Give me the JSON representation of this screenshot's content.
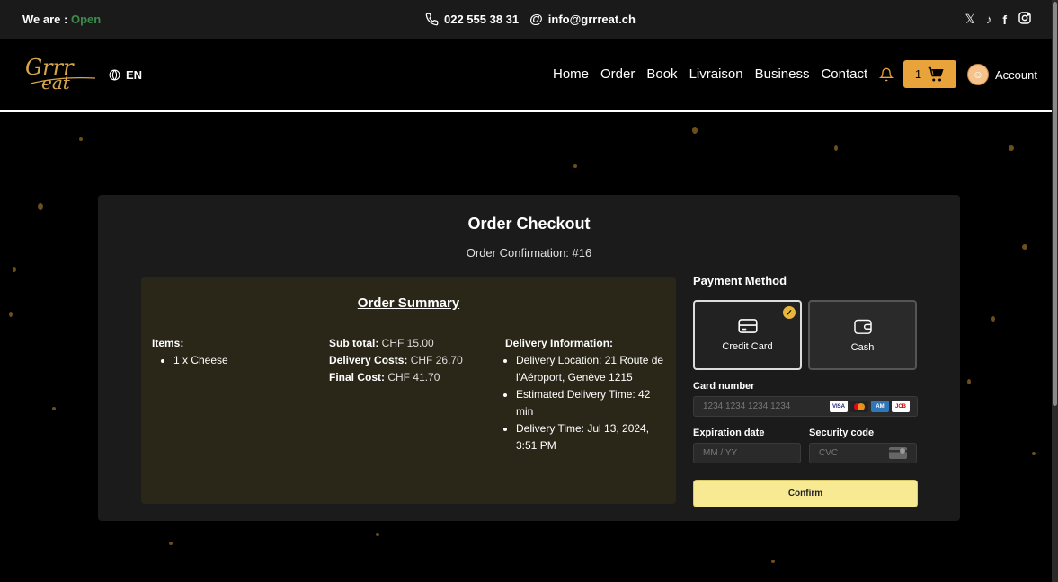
{
  "topbar": {
    "status_label": "We are :",
    "status_value": "Open",
    "phone": "022 555 38 31",
    "email": "info@grrreat.ch",
    "social_icons": [
      "x-icon",
      "tiktok-icon",
      "facebook-icon",
      "instagram-icon"
    ]
  },
  "nav": {
    "logo_text_top": "Grrr",
    "logo_text_bottom": "eat",
    "language": "EN",
    "menu": [
      "Home",
      "Order",
      "Book",
      "Livraison",
      "Business",
      "Contact"
    ],
    "cart_count": "1",
    "account_label": "Account"
  },
  "checkout": {
    "title": "Order Checkout",
    "confirmation": "Order Confirmation: #16",
    "summary": {
      "title": "Order Summary",
      "items_label": "Items:",
      "items": [
        "1 x Cheese"
      ],
      "subtotal_label": "Sub total:",
      "subtotal_value": "CHF 15.00",
      "delivery_label": "Delivery Costs:",
      "delivery_value": "CHF 26.70",
      "final_label": "Final Cost:",
      "final_value": "CHF 41.70",
      "delivery_info_label": "Delivery Information:",
      "delivery_info": [
        "Delivery Location: 21 Route de l'Aéroport, Genève 1215",
        "Estimated Delivery Time: 42 min",
        "Delivery Time: Jul 13, 2024, 3:51 PM"
      ]
    },
    "payment": {
      "title": "Payment Method",
      "methods": [
        "Credit Card",
        "Cash"
      ],
      "selected_method": "Credit Card",
      "card_number_label": "Card number",
      "card_number_placeholder": "1234 1234 1234 1234",
      "expiration_label": "Expiration date",
      "expiration_placeholder": "MM / YY",
      "security_label": "Security code",
      "security_placeholder": "CVC",
      "confirm_label": "Confirm"
    }
  },
  "colors": {
    "open": "#3d8b4b",
    "accent": "#e8a33b",
    "summary_bg": "#2b2718",
    "confirm_bg": "#f7ea93"
  }
}
